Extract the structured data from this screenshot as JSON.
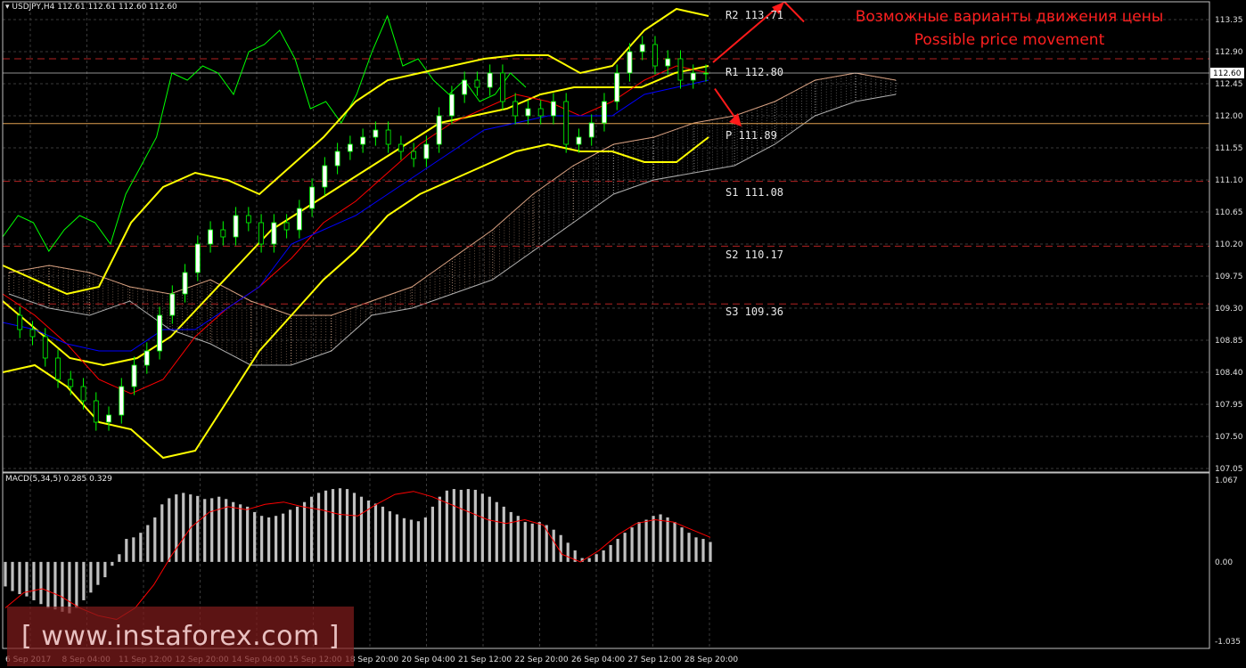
{
  "header": {
    "symbol_line": "USDJPY,H4  112.61 112.61 112.60 112.60",
    "macd_line": "MACD(5,34,5) 0.285 0.329"
  },
  "pivots": {
    "R2": "R2 113.71",
    "R1": "R1 112.80",
    "P": "P 111.89",
    "S1": "S1 111.08",
    "S2": "S2 110.17",
    "S3": "S3 109.36"
  },
  "annotation": {
    "ru": "Возможные варианты движения цены",
    "en": "Possible price movement"
  },
  "watermark": "[ www.instaforex.com ]",
  "colors": {
    "background": "#000000",
    "grid": "#3a3a3a",
    "bull_candle": "#ffffff",
    "bear_candle": "#000000",
    "candle_outline": "#00ff00",
    "bollinger": "#ffff00",
    "tenkan": "#ff0000",
    "kijun": "#0000ff",
    "chikou": "#00ff00",
    "kumo_a": "#ffccaa",
    "kumo_b": "#d0d0d0",
    "pivot_line": "#b22222",
    "current_price": "#c0c0c0",
    "macd_hist": "#c0c0c0",
    "macd_signal": "#ff0000",
    "annotation": "#ff2020"
  },
  "chart_data": [
    {
      "type": "candlestick",
      "title": "USDJPY,H4",
      "ylim": [
        107.0,
        113.6
      ],
      "y_ticks": [
        "113.35",
        "112.90",
        "112.45",
        "112.00",
        "111.55",
        "111.10",
        "110.65",
        "110.20",
        "109.75",
        "109.30",
        "108.85",
        "108.40",
        "107.95",
        "107.50",
        "107.05"
      ],
      "x_ticks": [
        "6 Sep 2017",
        "8 Sep 04:00",
        "11 Sep 12:00",
        "12 Sep 20:00",
        "14 Sep 04:00",
        "15 Sep 12:00",
        "18 Sep 20:00",
        "20 Sep 04:00",
        "21 Sep 12:00",
        "22 Sep 20:00",
        "26 Sep 04:00",
        "27 Sep 12:00",
        "28 Sep 20:00"
      ],
      "current_price": "112.60",
      "close_path": [
        109.2,
        109.0,
        108.9,
        108.6,
        108.3,
        108.2,
        108.0,
        107.7,
        107.8,
        108.2,
        108.5,
        108.7,
        109.2,
        109.5,
        109.8,
        110.2,
        110.4,
        110.3,
        110.6,
        110.5,
        110.2,
        110.5,
        110.4,
        110.7,
        111.0,
        111.3,
        111.5,
        111.6,
        111.7,
        111.8,
        111.6,
        111.5,
        111.4,
        111.6,
        112.0,
        112.3,
        112.5,
        112.4,
        112.6,
        112.2,
        112.0,
        112.1,
        112.0,
        112.2,
        111.6,
        111.7,
        111.9,
        112.2,
        112.6,
        112.9,
        113.0,
        112.7,
        112.8,
        112.5,
        112.6,
        112.6
      ],
      "bollinger_upper_path": [
        109.9,
        109.7,
        109.5,
        109.6,
        110.5,
        111.0,
        111.2,
        111.1,
        110.9,
        111.3,
        111.7,
        112.2,
        112.5,
        112.6,
        112.7,
        112.8,
        112.85,
        112.85,
        112.6,
        112.7,
        113.2,
        113.5,
        113.4
      ],
      "bollinger_middle_path": [
        109.4,
        109.0,
        108.6,
        108.5,
        108.6,
        108.9,
        109.4,
        109.9,
        110.4,
        110.7,
        111.0,
        111.3,
        111.6,
        111.9,
        112.0,
        112.1,
        112.3,
        112.4,
        112.4,
        112.4,
        112.6,
        112.7
      ],
      "bollinger_lower_path": [
        108.4,
        108.5,
        108.2,
        107.7,
        107.6,
        107.2,
        107.3,
        108.0,
        108.7,
        109.2,
        109.7,
        110.1,
        110.6,
        110.9,
        111.1,
        111.3,
        111.5,
        111.6,
        111.5,
        111.5,
        111.35,
        111.35,
        111.7
      ],
      "pivot_levels": [
        {
          "name": "R2",
          "value": 113.71
        },
        {
          "name": "R1",
          "value": 112.8
        },
        {
          "name": "P",
          "value": 111.89
        },
        {
          "name": "S1",
          "value": 111.08
        },
        {
          "name": "S2",
          "value": 110.17
        },
        {
          "name": "S3",
          "value": 109.36
        }
      ]
    },
    {
      "type": "bar",
      "title": "MACD(5,34,5) 0.285 0.329",
      "ylim": [
        -1.035,
        1.067
      ],
      "y_ticks": [
        "1.067",
        "0.00",
        "-1.035"
      ],
      "histogram": [
        -0.32,
        -0.38,
        -0.42,
        -0.45,
        -0.5,
        -0.55,
        -0.6,
        -0.62,
        -0.65,
        -0.67,
        -0.6,
        -0.5,
        -0.4,
        -0.3,
        -0.2,
        -0.05,
        0.1,
        0.3,
        0.32,
        0.38,
        0.48,
        0.58,
        0.75,
        0.83,
        0.88,
        0.9,
        0.88,
        0.86,
        0.82,
        0.83,
        0.85,
        0.82,
        0.78,
        0.75,
        0.72,
        0.65,
        0.6,
        0.58,
        0.6,
        0.63,
        0.68,
        0.72,
        0.78,
        0.85,
        0.9,
        0.93,
        0.95,
        0.96,
        0.95,
        0.9,
        0.85,
        0.8,
        0.76,
        0.72,
        0.66,
        0.62,
        0.57,
        0.55,
        0.53,
        0.58,
        0.72,
        0.85,
        0.93,
        0.95,
        0.94,
        0.95,
        0.94,
        0.89,
        0.85,
        0.78,
        0.72,
        0.65,
        0.6,
        0.52,
        0.5,
        0.52,
        0.48,
        0.42,
        0.35,
        0.25,
        0.15,
        0.05,
        0.05,
        0.1,
        0.15,
        0.22,
        0.3,
        0.38,
        0.45,
        0.52,
        0.55,
        0.6,
        0.62,
        0.58,
        0.52,
        0.45,
        0.38,
        0.32,
        0.3,
        0.26
      ],
      "signal_path": [
        -0.6,
        -0.4,
        -0.35,
        -0.45,
        -0.6,
        -0.7,
        -0.75,
        -0.6,
        -0.3,
        0.1,
        0.45,
        0.65,
        0.72,
        0.68,
        0.75,
        0.78,
        0.72,
        0.68,
        0.62,
        0.6,
        0.75,
        0.88,
        0.92,
        0.85,
        0.75,
        0.65,
        0.55,
        0.5,
        0.55,
        0.48,
        0.1,
        0.0,
        0.15,
        0.35,
        0.5,
        0.55,
        0.52,
        0.42,
        0.32
      ]
    }
  ]
}
